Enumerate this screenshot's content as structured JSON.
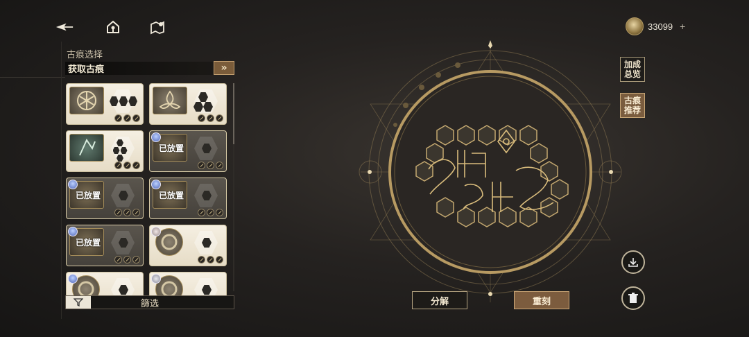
{
  "header": {
    "back_icon": "back-arrow-icon",
    "home_icon": "home-icon",
    "guide_icon": "map-guide-icon",
    "currency": {
      "icon": "gold-coin-icon",
      "amount": "33099",
      "plus": "+"
    }
  },
  "left_panel": {
    "title": "古痕选择",
    "acquire_label": "获取古痕",
    "acquire_button": "»",
    "placed_label": "已放置",
    "cards": [
      {
        "placed": false,
        "shape": "3-hex-row"
      },
      {
        "placed": false,
        "shape": "3-hex-triangle"
      },
      {
        "placed": false,
        "shape": "6-hex-pyramid"
      },
      {
        "placed": true,
        "shape": "1-hex"
      },
      {
        "placed": true,
        "shape": "1-hex"
      },
      {
        "placed": true,
        "shape": "1-hex"
      },
      {
        "placed": true,
        "shape": "1-hex"
      },
      {
        "placed": false,
        "shape": "1-hex"
      },
      {
        "placed": false,
        "shape": "1-hex"
      },
      {
        "placed": false,
        "shape": "1-hex"
      }
    ],
    "filter_label": "篩选"
  },
  "side_buttons": {
    "bonus_overview": "加成总览",
    "recommend": "古痕推荐",
    "save_icon": "download-icon",
    "delete_icon": "trash-icon"
  },
  "actions": {
    "decompose": "分解",
    "reengrave": "重刻"
  },
  "colors": {
    "accent_gold": "#c9a66b",
    "brown_button": "#7a5c3e",
    "background": "#252220"
  }
}
